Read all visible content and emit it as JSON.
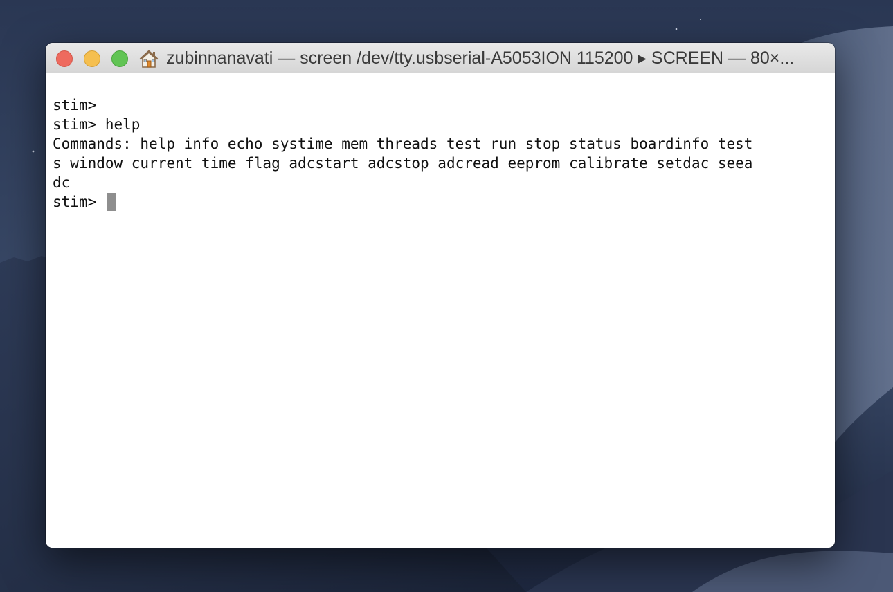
{
  "window": {
    "title": "zubinnanavati — screen /dev/tty.usbserial-A5053ION 115200 ▸ SCREEN — 80×..."
  },
  "icons": {
    "title_icon": "home-icon",
    "close": "close-button",
    "minimize": "minimize-button",
    "zoom": "zoom-button"
  },
  "colors": {
    "close": "#ee6a5e",
    "minimize": "#f5bf4f",
    "zoom": "#61c454",
    "cursor": "#8e8e8e"
  },
  "terminal": {
    "lines": [
      "stim>",
      "stim> help",
      "Commands: help info echo systime mem threads test run stop status boardinfo test",
      "s window current time flag adcstart adcstop adcread eeprom calibrate setdac seea",
      "dc"
    ],
    "prompt": "stim> "
  }
}
